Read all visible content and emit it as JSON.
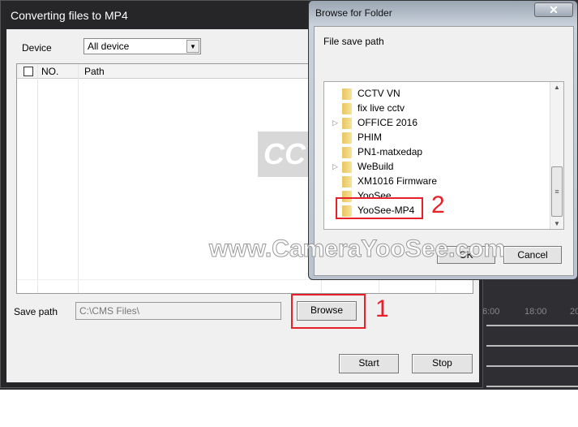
{
  "main_window": {
    "title": "Converting files to MP4",
    "device_label": "Device",
    "device_value": "All device",
    "table": {
      "columns": [
        "",
        "NO.",
        "Path"
      ],
      "rows": []
    },
    "save_path_label": "Save path",
    "save_path_value": "C:\\CMS Files\\",
    "browse": "Browse",
    "start": "Start",
    "stop": "Stop"
  },
  "timeline": {
    "ticks": [
      "6:00",
      "18:00",
      "20"
    ]
  },
  "dialog": {
    "title": "Browse for Folder",
    "close": "✕",
    "description": "File save path",
    "folders": [
      {
        "name": "CCTV VN",
        "expandable": false
      },
      {
        "name": "fix live cctv",
        "expandable": false
      },
      {
        "name": "OFFICE 2016",
        "expandable": true
      },
      {
        "name": "PHIM",
        "expandable": false
      },
      {
        "name": "PN1-matxedap",
        "expandable": false
      },
      {
        "name": "WeBuild",
        "expandable": true
      },
      {
        "name": "XM1016 Firmware",
        "expandable": false
      },
      {
        "name": "YooSee",
        "expandable": false
      },
      {
        "name": "YooSee-MP4",
        "expandable": false
      }
    ],
    "ok": "OK",
    "cancel": "Cancel"
  },
  "annotations": {
    "step1": "1",
    "step2": "2",
    "color": "#e8202a"
  },
  "watermark": {
    "text": "www.CameraYooSee.com",
    "logo": "CCTV"
  }
}
